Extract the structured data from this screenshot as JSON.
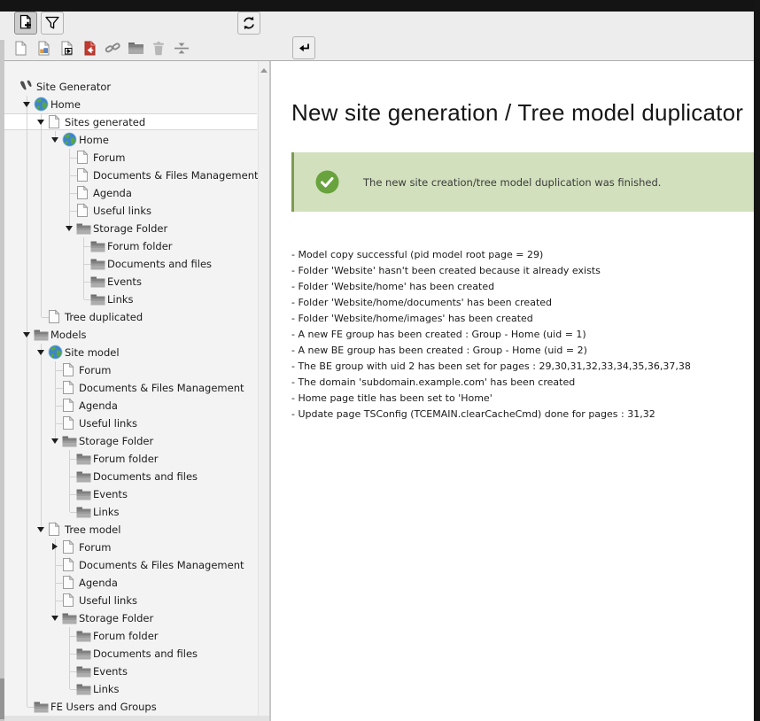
{
  "toolbar": {
    "primary_buttons": [
      {
        "name": "new-page-toggle-button",
        "icon": "page-new-icon",
        "active": true
      },
      {
        "name": "filter-toggle-button",
        "icon": "filter-icon",
        "active": false
      },
      {
        "name": "refresh-tree-button",
        "icon": "refresh-icon",
        "active": false
      }
    ],
    "drag_icons": [
      {
        "name": "drag-new-page",
        "icon": "page-icon"
      },
      {
        "name": "drag-new-page-content",
        "icon": "page-content-icon"
      },
      {
        "name": "drag-new-shortcut-page",
        "icon": "page-shortcut-icon"
      },
      {
        "name": "drag-new-mountpoint-page",
        "icon": "page-red-icon"
      },
      {
        "name": "drag-new-link",
        "icon": "link-icon"
      },
      {
        "name": "drag-new-folder",
        "icon": "folder-icon"
      },
      {
        "name": "drag-trash",
        "icon": "trash-icon"
      },
      {
        "name": "drag-separator",
        "icon": "separator-icon"
      }
    ],
    "enter_button": {
      "name": "enter-button",
      "icon": "return-icon"
    }
  },
  "tree": {
    "items": [
      {
        "label": "Site Generator",
        "level": 0,
        "icon": "typo3-icon",
        "expander": null
      },
      {
        "label": "Home",
        "level": 1,
        "icon": "globe-icon",
        "expander": "open"
      },
      {
        "label": "Sites generated",
        "level": 2,
        "icon": "page-tree-icon",
        "expander": "open",
        "selected": true
      },
      {
        "label": "Home",
        "level": 3,
        "icon": "globe-icon",
        "expander": "open"
      },
      {
        "label": "Forum",
        "level": 4,
        "icon": "page-tree-icon",
        "expander": null
      },
      {
        "label": "Documents & Files Management",
        "level": 4,
        "icon": "page-tree-icon",
        "expander": null
      },
      {
        "label": "Agenda",
        "level": 4,
        "icon": "page-tree-icon",
        "expander": null
      },
      {
        "label": "Useful links",
        "level": 4,
        "icon": "page-tree-icon",
        "expander": null
      },
      {
        "label": "Storage Folder",
        "level": 4,
        "icon": "folder-tree-icon",
        "expander": "open"
      },
      {
        "label": "Forum folder",
        "level": 5,
        "icon": "folder-tree-icon",
        "expander": null
      },
      {
        "label": "Documents and files",
        "level": 5,
        "icon": "folder-tree-icon",
        "expander": null
      },
      {
        "label": "Events",
        "level": 5,
        "icon": "folder-tree-icon",
        "expander": null
      },
      {
        "label": "Links",
        "level": 5,
        "icon": "folder-tree-icon",
        "expander": null
      },
      {
        "label": "Tree duplicated",
        "level": 2,
        "icon": "page-tree-icon",
        "expander": null
      },
      {
        "label": "Models",
        "level": 1,
        "icon": "folder-tree-icon",
        "expander": "open"
      },
      {
        "label": "Site model",
        "level": 2,
        "icon": "globe-icon",
        "expander": "open"
      },
      {
        "label": "Forum",
        "level": 3,
        "icon": "page-tree-icon",
        "expander": null
      },
      {
        "label": "Documents & Files Management",
        "level": 3,
        "icon": "page-tree-icon",
        "expander": null
      },
      {
        "label": "Agenda",
        "level": 3,
        "icon": "page-tree-icon",
        "expander": null
      },
      {
        "label": "Useful links",
        "level": 3,
        "icon": "page-tree-icon",
        "expander": null
      },
      {
        "label": "Storage Folder",
        "level": 3,
        "icon": "folder-tree-icon",
        "expander": "open"
      },
      {
        "label": "Forum folder",
        "level": 4,
        "icon": "folder-tree-icon",
        "expander": null
      },
      {
        "label": "Documents and files",
        "level": 4,
        "icon": "folder-tree-icon",
        "expander": null
      },
      {
        "label": "Events",
        "level": 4,
        "icon": "folder-tree-icon",
        "expander": null
      },
      {
        "label": "Links",
        "level": 4,
        "icon": "folder-tree-icon",
        "expander": null
      },
      {
        "label": "Tree model",
        "level": 2,
        "icon": "page-tree-icon",
        "expander": "open"
      },
      {
        "label": "Forum",
        "level": 3,
        "icon": "page-tree-icon",
        "expander": "closed"
      },
      {
        "label": "Documents & Files Management",
        "level": 3,
        "icon": "page-tree-icon",
        "expander": null
      },
      {
        "label": "Agenda",
        "level": 3,
        "icon": "page-tree-icon",
        "expander": null
      },
      {
        "label": "Useful links",
        "level": 3,
        "icon": "page-tree-icon",
        "expander": null
      },
      {
        "label": "Storage Folder",
        "level": 3,
        "icon": "folder-tree-icon",
        "expander": "open"
      },
      {
        "label": "Forum folder",
        "level": 4,
        "icon": "folder-tree-icon",
        "expander": null
      },
      {
        "label": "Documents and files",
        "level": 4,
        "icon": "folder-tree-icon",
        "expander": null
      },
      {
        "label": "Events",
        "level": 4,
        "icon": "folder-tree-icon",
        "expander": null
      },
      {
        "label": "Links",
        "level": 4,
        "icon": "folder-tree-icon",
        "expander": null
      },
      {
        "label": "FE Users and Groups",
        "level": 1,
        "icon": "folder-tree-icon",
        "expander": null
      }
    ]
  },
  "content": {
    "title": "New site generation / Tree model duplicator",
    "alert": {
      "type": "success",
      "icon": "check-circle-icon",
      "text": "The new site creation/tree model duplication was finished."
    },
    "log_lines": [
      "- Model copy successful (pid model root page = 29)",
      "- Folder 'Website' hasn't been created because it already exists",
      "- Folder 'Website/home' has been created",
      "- Folder 'Website/home/documents' has been created",
      "- Folder 'Website/home/images' has been created",
      "- A new FE group has been created : Group - Home (uid = 1)",
      "- A new BE group has been created : Group - Home (uid = 2)",
      "- The BE group with uid 2 has been set for pages : 29,30,31,32,33,34,35,36,37,38",
      "- The domain 'subdomain.example.com' has been created",
      "- Home page title has been set to 'Home'",
      "- Update page TSConfig (TCEMAIN.clearCacheCmd) done for pages : 31,32"
    ]
  },
  "colors": {
    "success_bg": "#d2e0bd",
    "success_border": "#7d9b52",
    "success_icon": "#68a33d",
    "toolbar_bg": "#ededed",
    "tree_bg": "#f3f3f3",
    "topbar_bg": "#141414"
  }
}
